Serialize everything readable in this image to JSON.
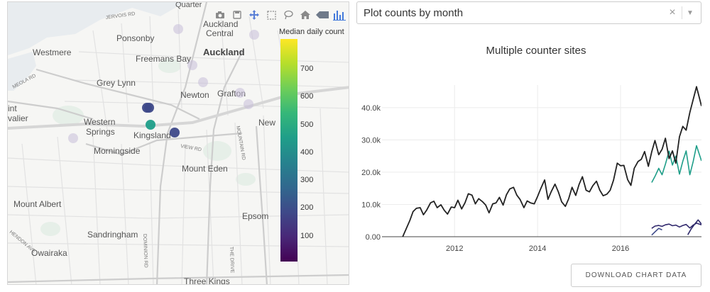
{
  "map": {
    "labels": {
      "jervois": "JERVOIS RD",
      "quarter": "Quarter",
      "auckland_central_1": "Auckland",
      "auckland_central_2": "Central",
      "ponsonby": "Ponsonby",
      "westmere": "Westmere",
      "freemans_bay": "Freemans Bay",
      "auckland": "Auckland",
      "grey_lynn": "Grey Lynn",
      "meola": "MEOLA RD",
      "newton": "Newton",
      "grafton": "Grafton",
      "int": "int",
      "valier": "valier",
      "western_1": "Western",
      "western_2": "Springs",
      "kingsland": "Kingsland",
      "new": "New",
      "mountain_rd": "MOUNTAIN RD",
      "view_rd": "VIEW RD",
      "morningside": "Morningside",
      "mount_eden": "Mount Eden",
      "mount_albert": "Mount Albert",
      "epsom": "Epsom",
      "sandringham": "Sandringham",
      "dominion_rd": "DOMINION RD",
      "the_drive": "THE DRIVE",
      "owairaka": "Owairaka",
      "hendon_ave": "HENDON AVE",
      "three_kings": "Three Kings"
    },
    "sites": [
      {
        "median_daily_count": 180
      },
      {
        "median_daily_count": 190
      },
      {
        "median_daily_count": 460
      },
      {
        "median_daily_count": 150
      },
      {
        "median_daily_count": null
      },
      {
        "median_daily_count": null
      },
      {
        "median_daily_count": null
      },
      {
        "median_daily_count": null
      },
      {
        "median_daily_count": null
      },
      {
        "median_daily_count": null
      },
      {
        "median_daily_count": null
      }
    ],
    "colorbar": {
      "title": "Median daily count",
      "ticks": [
        "700",
        "600",
        "500",
        "400",
        "300",
        "200",
        "100"
      ],
      "tick_values": [
        700,
        600,
        500,
        400,
        300,
        200,
        100
      ],
      "min": 10,
      "max": 810,
      "colors": [
        "#440154",
        "#482878",
        "#3e4989",
        "#31688e",
        "#26828e",
        "#1f9e89",
        "#35b779",
        "#6ece58",
        "#b5de2b",
        "#fde725"
      ]
    },
    "modebar": [
      "camera-icon",
      "save-icon",
      "pan-icon",
      "box-select-icon",
      "lasso-icon",
      "home-icon",
      "tag-icon",
      "plotly-logo-icon"
    ]
  },
  "dropdown": {
    "value": "Plot counts by month",
    "clear": "×",
    "arrow": "▼"
  },
  "chart_data": {
    "type": "line",
    "title": "Multiple counter sites",
    "xlabel": "",
    "ylabel": "",
    "xlim": [
      2010.25,
      2017.95
    ],
    "ylim": [
      0,
      47000
    ],
    "x_ticks": [
      {
        "label": "2012",
        "value": 2012
      },
      {
        "label": "2014",
        "value": 2014
      },
      {
        "label": "2016",
        "value": 2016
      }
    ],
    "y_ticks": [
      {
        "label": "0.00",
        "value": 0
      },
      {
        "label": "10.0k",
        "value": 10000
      },
      {
        "label": "20.0k",
        "value": 20000
      },
      {
        "label": "30.0k",
        "value": 30000
      },
      {
        "label": "40.0k",
        "value": 40000
      }
    ],
    "grid": true,
    "colors": {
      "total": "#222222",
      "teal": "#1f9e89",
      "navy_a": "#31296d",
      "navy_b": "#3e4a89",
      "navy_c": "#2e2a6a"
    },
    "series": [
      {
        "key": "total",
        "x": [
          2010.75,
          2010.92,
          2011.0,
          2011.08,
          2011.17,
          2011.25,
          2011.33,
          2011.42,
          2011.5,
          2011.58,
          2011.67,
          2011.75,
          2011.83,
          2011.92,
          2012.0,
          2012.08,
          2012.17,
          2012.25,
          2012.33,
          2012.42,
          2012.5,
          2012.58,
          2012.67,
          2012.75,
          2012.83,
          2012.92,
          2013.0,
          2013.08,
          2013.17,
          2013.25,
          2013.33,
          2013.42,
          2013.5,
          2013.58,
          2013.67,
          2013.75,
          2013.83,
          2013.92,
          2014.0,
          2014.08,
          2014.17,
          2014.25,
          2014.33,
          2014.42,
          2014.5,
          2014.58,
          2014.67,
          2014.75,
          2014.83,
          2014.92,
          2015.0,
          2015.08,
          2015.17,
          2015.25,
          2015.33,
          2015.42,
          2015.5,
          2015.58,
          2015.67,
          2015.75,
          2015.83,
          2015.92,
          2016.0,
          2016.08,
          2016.17,
          2016.25,
          2016.33,
          2016.42,
          2016.5,
          2016.58,
          2016.67,
          2016.75,
          2016.83,
          2016.92,
          2017.0,
          2017.08,
          2017.17,
          2017.25,
          2017.33,
          2017.42,
          2017.5,
          2017.58,
          2017.67,
          2017.75,
          2017.83,
          2017.95
        ],
        "y": [
          0,
          5000,
          7800,
          8800,
          9000,
          6800,
          8300,
          10500,
          11000,
          9000,
          9900,
          8200,
          7000,
          9200,
          9000,
          11300,
          8600,
          10500,
          13300,
          12900,
          10200,
          11800,
          10900,
          9800,
          7400,
          10200,
          10500,
          12200,
          9800,
          13000,
          14800,
          15300,
          12900,
          11500,
          9000,
          11100,
          10500,
          10200,
          12500,
          15000,
          17600,
          11600,
          14000,
          16300,
          13900,
          10800,
          9400,
          11800,
          15300,
          12800,
          16200,
          18600,
          14400,
          13900,
          15800,
          17200,
          14400,
          12700,
          13200,
          14400,
          17500,
          22800,
          22000,
          22100,
          17700,
          15900,
          21200,
          23300,
          24000,
          26400,
          21800,
          26300,
          29800,
          25400,
          27100,
          30500,
          24200,
          26600,
          22800,
          31000,
          34200,
          33000,
          38500,
          42500,
          46500,
          40500
        ]
      },
      {
        "key": "teal",
        "x": [
          2016.75,
          2016.83,
          2016.92,
          2017.0,
          2017.08,
          2017.17,
          2017.25,
          2017.33,
          2017.42,
          2017.5,
          2017.58,
          2017.67,
          2017.75,
          2017.83,
          2017.95
        ],
        "y": [
          16800,
          18700,
          21200,
          19200,
          22500,
          26500,
          22200,
          25000,
          19400,
          23400,
          26600,
          19200,
          23300,
          28200,
          23500
        ]
      },
      {
        "key": "navy_a",
        "x": [
          2016.75,
          2016.83,
          2016.92,
          2017.0,
          2017.08,
          2017.17,
          2017.25,
          2017.33,
          2017.42,
          2017.5,
          2017.58,
          2017.67,
          2017.75,
          2017.83,
          2017.95
        ],
        "y": [
          2600,
          3300,
          3500,
          3200,
          3700,
          3900,
          3400,
          3600,
          3000,
          3500,
          3800,
          2700,
          3600,
          4200,
          3700
        ]
      },
      {
        "key": "navy_b",
        "x": [
          2016.75,
          2016.83,
          2016.92,
          2017.0
        ],
        "y": [
          500,
          1500,
          2600,
          2100
        ]
      },
      {
        "key": "navy_c",
        "x": [
          2017.62,
          2017.7,
          2017.78,
          2017.87,
          2017.95
        ],
        "y": [
          600,
          2400,
          3800,
          5200,
          3900
        ]
      }
    ]
  },
  "actions": {
    "download": "DOWNLOAD CHART DATA"
  }
}
